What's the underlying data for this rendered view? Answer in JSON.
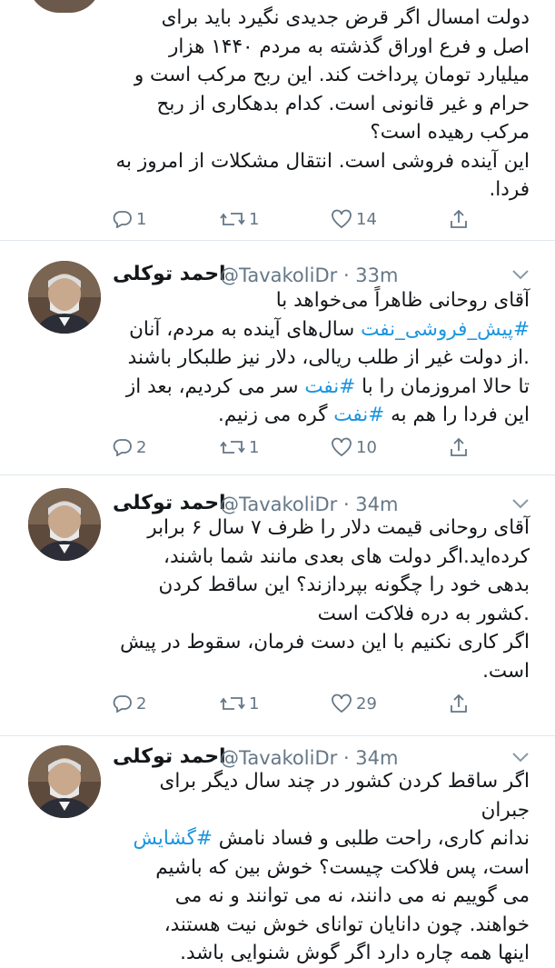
{
  "tweets": [
    {
      "partial": true,
      "lines": [
        "دولت امسال اگر قرض جدیدی نگیرد باید برای",
        "اصل و فرع اوراق گذشته به مردم ۱۴۴۰ هزار",
        "میلیارد تومان پرداخت کند. این ربح مرکب است و",
        "حرام و غیر قانونی است. کدام بدهکاری از ربح",
        "مرکب رهیده است؟",
        "این آینده فروشی است. انتقال مشکلات از امروز به",
        "فردا."
      ],
      "replies": "1",
      "retweets": "1",
      "likes": "14"
    },
    {
      "name": "احمد توکلی",
      "handle": "@TavakoliDr",
      "time": "· 33m",
      "line1": "آقای روحانی ظاهراً می‌خواهد با",
      "l2_tag": "#پیش_فروشی_نفت",
      "l2_text": " سال‌های آینده به مردم، آنان",
      "line3": ".از دولت غیر از طلب ریالی، دلار نیز طلبکار باشند",
      "l4_a": "تا حالا امروزمان را با ",
      "l4_tag": "#نفت",
      "l4_b": " سر می کردیم،  بعد از",
      "l5_a": "این فردا را هم به ",
      "l5_tag": "#نفت",
      "l5_b": " گره می زنیم.",
      "replies": "2",
      "retweets": "1",
      "likes": "10"
    },
    {
      "name": "احمد توکلی",
      "handle": "@TavakoliDr",
      "time": "· 34m",
      "lines": [
        "آقای روحانی قیمت دلار را ظرف ۷ سال ۶ برابر",
        "کرده‌اید.اگر دولت های بعدی مانند شما باشند،",
        "بدهی خود را چگونه بپردازند؟ این ساقط کردن",
        ".کشور به دره فلاکت است",
        "اگر کاری نکنیم با این دست فرمان، سقوط در پیش",
        "است."
      ],
      "replies": "2",
      "retweets": "1",
      "likes": "29"
    },
    {
      "name": "احمد توکلی",
      "handle": "@TavakoliDr",
      "time": "· 34m",
      "line1": "اگر ساقط کردن کشور در چند سال دیگر برای جبران",
      "l2_text": "ندانم کاری، راحت طلبی و فساد نامش ",
      "l2_tag": "#گشایش",
      "line3": "است، پس  فلاکت چیست؟ خوش بین که باشیم",
      "line4": "می گوییم نه می دانند، نه می توانند و نه می",
      "line5": "خواهند. چون دانایان توانای خوش نیت هستند،",
      "line6": "اینها همه چاره دارد اگر گوش شنوایی باشد."
    }
  ]
}
